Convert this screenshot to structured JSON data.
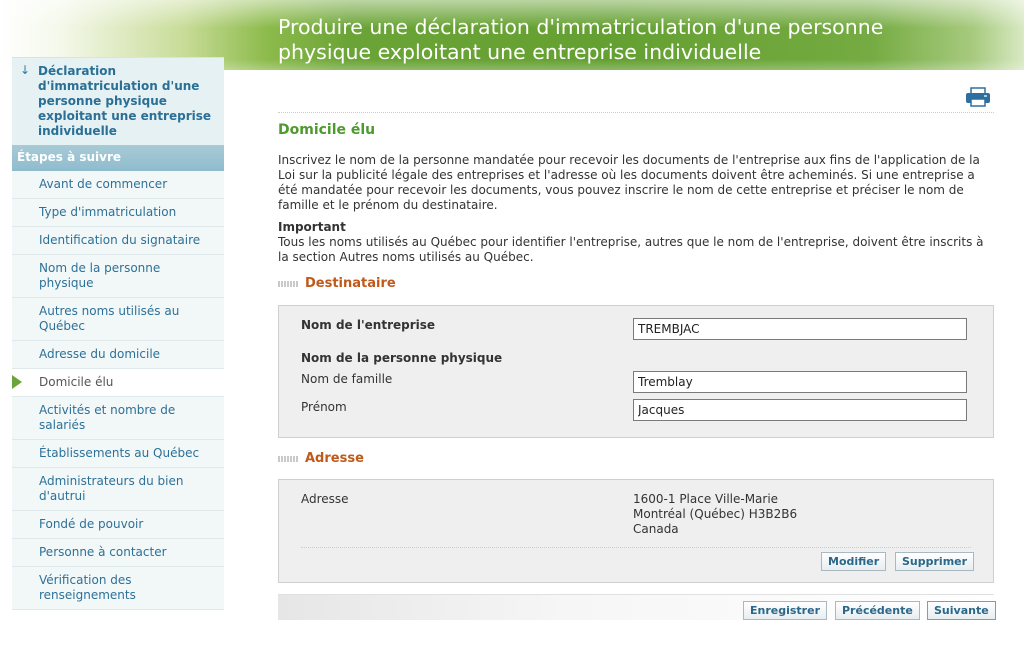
{
  "page": {
    "title": "Produire une déclaration d'immatriculation d'une personne physique exploitant une entreprise individuelle"
  },
  "sidebar": {
    "current_arrow": "↓",
    "current": "Déclaration d'immatriculation d'une personne physique exploitant une entreprise individuelle",
    "steps_heading": "Étapes à suivre",
    "items": [
      {
        "label": "Avant de commencer"
      },
      {
        "label": "Type d'immatriculation"
      },
      {
        "label": "Identification du signataire"
      },
      {
        "label": "Nom de la personne physique"
      },
      {
        "label": "Autres noms utilisés au Québec"
      },
      {
        "label": "Adresse du domicile"
      },
      {
        "label": "Domicile élu"
      },
      {
        "label": "Activités et nombre de salariés"
      },
      {
        "label": "Établissements au Québec"
      },
      {
        "label": "Administrateurs du bien d'autrui"
      },
      {
        "label": "Fondé de pouvoir"
      },
      {
        "label": "Personne à contacter"
      },
      {
        "label": "Vérification des renseignements"
      }
    ],
    "active_index": 6
  },
  "main": {
    "print_icon": "printer-icon",
    "section_title": "Domicile élu",
    "intro": "Inscrivez le nom de la personne mandatée pour recevoir les documents de l'entreprise aux fins de l'application de la Loi sur la publicité légale des entreprises et l'adresse où les documents doivent être acheminés. Si une entreprise a été mandatée pour recevoir les documents, vous pouvez inscrire le nom de cette entreprise et préciser le nom de famille et le prénom du destinataire.",
    "important_label": "Important",
    "important_text": "Tous les noms utilisés au Québec pour identifier l'entreprise, autres que le nom de l'entreprise, doivent être inscrits à la section Autres noms utilisés au Québec.",
    "destinataire": {
      "heading": "Destinataire",
      "company_label": "Nom de l'entreprise",
      "company_value": "TREMBJAC",
      "person_heading": "Nom de la personne physique",
      "lastname_label": "Nom de famille",
      "lastname_value": "Tremblay",
      "firstname_label": "Prénom",
      "firstname_value": "Jacques"
    },
    "adresse": {
      "heading": "Adresse",
      "label": "Adresse",
      "line1": "1600-1 Place Ville-Marie",
      "line2": "Montréal (Québec) H3B2B6",
      "line3": "Canada",
      "modify_label": "Modifier",
      "delete_label": "Supprimer"
    },
    "footer": {
      "save_label": "Enregistrer",
      "previous_label": "Précédente",
      "next_label": "Suivante"
    }
  },
  "colors": {
    "green_title": "#4e9a2e",
    "orange_heading": "#c05a1a",
    "link_blue": "#2d7198"
  }
}
